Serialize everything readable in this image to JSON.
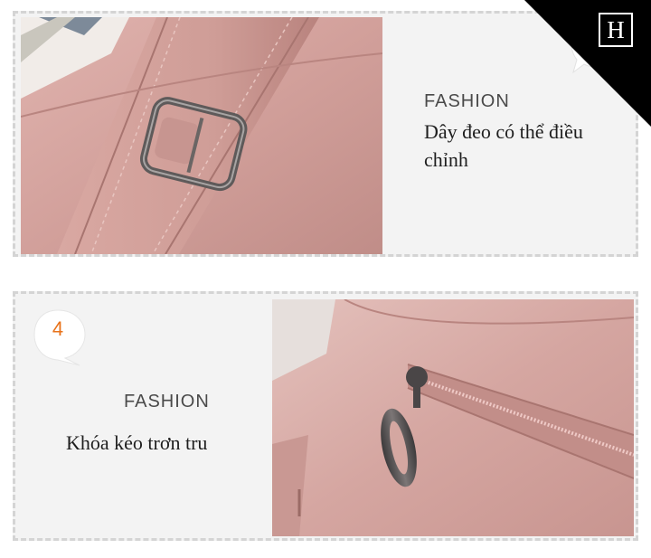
{
  "section_top": {
    "brand": "FASHION",
    "description": "Dây đeo có thể điều chỉnh"
  },
  "section_bottom": {
    "number": "4",
    "brand": "FASHION",
    "description": "Khóa kéo trơn tru"
  },
  "logo": {
    "letter": "H"
  },
  "colors": {
    "leather_pink": "#d6a7a2",
    "number_orange": "#e8731b",
    "corner_black": "#000000"
  }
}
